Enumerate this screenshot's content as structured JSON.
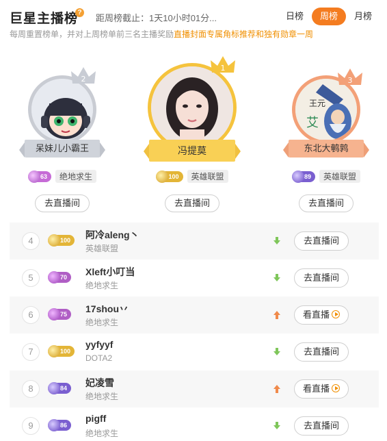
{
  "header": {
    "title": "巨星主播榜",
    "help_icon": "question-icon",
    "deadline": "距周榜截止：1天10小时01分...",
    "tabs": [
      {
        "label": "日榜",
        "active": false
      },
      {
        "label": "周榜",
        "active": true
      },
      {
        "label": "月榜",
        "active": false
      }
    ],
    "subtitle_plain": "每周重置榜单，并对上周榜单前三名主播奖励",
    "subtitle_highlight": "直播封面专属角标推荐和独有勋章一周"
  },
  "colors": {
    "accent": "#f47c20",
    "highlight": "#f08f00",
    "rank1": "#f5c33d",
    "rank2": "#c9ccd3",
    "rank3": "#f3a077",
    "trend_up": "#f08a4b",
    "trend_down": "#7fc65a"
  },
  "top3": [
    {
      "rank": "2",
      "name": "呆妹儿小霸王",
      "level": "63",
      "game": "绝地求生",
      "button": "去直播间",
      "crown_icon": "silver-crown-icon"
    },
    {
      "rank": "1",
      "name": "冯提莫",
      "level": "100",
      "game": "英雄联盟",
      "button": "去直播间",
      "crown_icon": "gold-crown-icon"
    },
    {
      "rank": "3",
      "name": "东北大鹌鹑",
      "level": "89",
      "game": "英雄联盟",
      "button": "去直播间",
      "crown_icon": "bronze-crown-icon"
    }
  ],
  "list": [
    {
      "rank": "4",
      "level": "100",
      "name": "阿冷aleng丶",
      "game": "英雄联盟",
      "trend": "down",
      "button": "去直播间"
    },
    {
      "rank": "5",
      "level": "70",
      "name": "Xleft小叮当",
      "game": "绝地求生",
      "trend": "down",
      "button": "去直播间"
    },
    {
      "rank": "6",
      "level": "75",
      "name": "17shou丷",
      "game": "绝地求生",
      "trend": "up",
      "button": "看直播"
    },
    {
      "rank": "7",
      "level": "100",
      "name": "yyfyyf",
      "game": "DOTA2",
      "trend": "down",
      "button": "去直播间"
    },
    {
      "rank": "8",
      "level": "84",
      "name": "妃凌雪",
      "game": "绝地求生",
      "trend": "up",
      "button": "看直播"
    },
    {
      "rank": "9",
      "level": "86",
      "name": "pigff",
      "game": "绝地求生",
      "trend": "down",
      "button": "去直播间"
    }
  ]
}
